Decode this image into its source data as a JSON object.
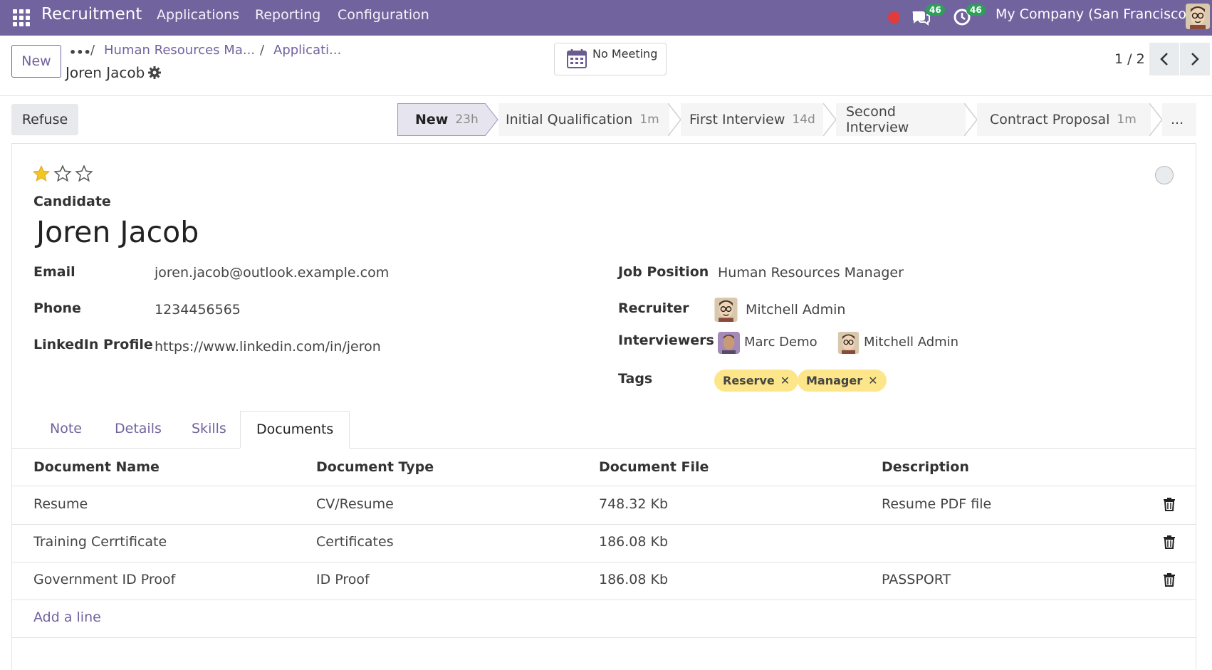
{
  "navbar": {
    "app_name": "Recruitment",
    "menu": [
      "Applications",
      "Reporting",
      "Configuration"
    ],
    "messages_count": "46",
    "activities_count": "46",
    "company": "My Company (San Francisco)"
  },
  "control": {
    "new_label": "New",
    "breadcrumb": [
      "Human Resources Ma...",
      "Applicati..."
    ],
    "record_title": "Joren Jacob",
    "meeting_label": "No Meeting",
    "pager": "1 / 2"
  },
  "status": {
    "refuse_label": "Refuse",
    "stages": [
      {
        "name": "New",
        "duration": "23h"
      },
      {
        "name": "Initial Qualification",
        "duration": "1m"
      },
      {
        "name": "First Interview",
        "duration": "14d"
      },
      {
        "name": "Second Interview",
        "duration": ""
      },
      {
        "name": "Contract Proposal",
        "duration": "1m"
      }
    ],
    "more_label": "...",
    "active_stage": "New"
  },
  "form": {
    "rating": 1,
    "rating_max": 3,
    "candidate_label": "Candidate",
    "candidate_name": "Joren Jacob",
    "email_label": "Email",
    "email": "joren.jacob@outlook.example.com",
    "phone_label": "Phone",
    "phone": "1234456565",
    "linkedin_label": "LinkedIn Profile",
    "linkedin": "https://www.linkedin.com/in/jeron",
    "job_label": "Job Position",
    "job": "Human Resources Manager",
    "recruiter_label": "Recruiter",
    "recruiter": "Mitchell Admin",
    "interviewers_label": "Interviewers",
    "interviewers": [
      "Marc Demo",
      "Mitchell Admin"
    ],
    "tags_label": "Tags",
    "tags": [
      "Reserve",
      "Manager"
    ],
    "tag_color": "#fde68a"
  },
  "tabs": [
    "Note",
    "Details",
    "Skills",
    "Documents"
  ],
  "active_tab": "Documents",
  "documents": {
    "columns": [
      "Document Name",
      "Document Type",
      "Document File",
      "Description"
    ],
    "rows": [
      {
        "name": "Resume",
        "type": "CV/Resume",
        "file": "748.32 Kb",
        "description": "Resume PDF file"
      },
      {
        "name": "Training Cerrtificate",
        "type": "Certificates",
        "file": "186.08 Kb",
        "description": ""
      },
      {
        "name": "Government ID Proof",
        "type": "ID Proof",
        "file": "186.08 Kb",
        "description": "PASSPORT"
      }
    ],
    "add_line": "Add a line"
  },
  "colors": {
    "brand": "#71639e",
    "star": "#f3c623"
  }
}
